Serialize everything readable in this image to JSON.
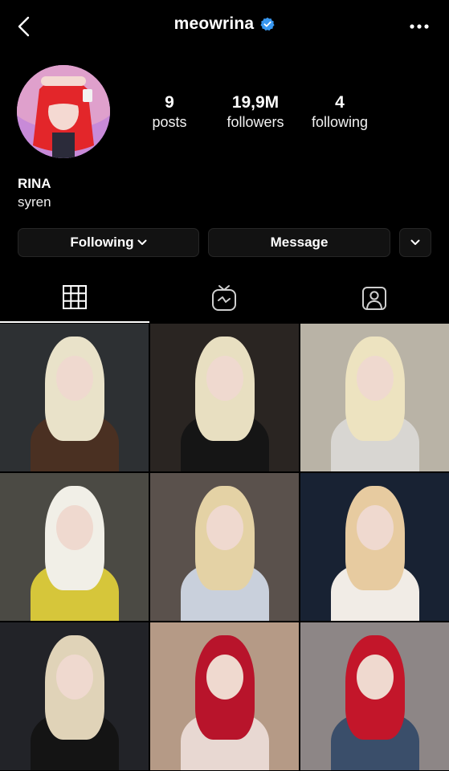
{
  "header": {
    "username": "meowrina",
    "back_icon": "chevron-left-icon",
    "verified_icon": "verified-badge-icon",
    "verified_color": "#3897f0",
    "more_icon": "more-horizontal-icon"
  },
  "profile": {
    "stats": {
      "posts_count": "9",
      "posts_label": "posts",
      "followers_count": "19,9M",
      "followers_label": "followers",
      "following_count": "4",
      "following_label": "following"
    },
    "display_name": "RINA",
    "bio": "syren"
  },
  "actions": {
    "following_label": "Following",
    "message_label": "Message"
  },
  "tabs": [
    {
      "icon": "grid-icon",
      "active": true
    },
    {
      "icon": "igtv-icon",
      "active": false
    },
    {
      "icon": "tagged-icon",
      "active": false
    }
  ],
  "grid": {
    "posts": [
      {
        "bg": "#2d3033",
        "hair": "#e9e2c9",
        "body": "#4a3022"
      },
      {
        "bg": "#2a2522",
        "hair": "#e8dfc1",
        "body": "#151515"
      },
      {
        "bg": "#b9b3a6",
        "hair": "#ede3c0",
        "body": "#d8d6d2"
      },
      {
        "bg": "#4b4a44",
        "hair": "#f1efe7",
        "body": "#d6c63a"
      },
      {
        "bg": "#5a514c",
        "hair": "#e4d2a5",
        "body": "#c9d0dc"
      },
      {
        "bg": "#182233",
        "hair": "#e7cba0",
        "body": "#f1ece6"
      },
      {
        "bg": "#222328",
        "hair": "#e0d3b8",
        "body": "#141414"
      },
      {
        "bg": "#b59a86",
        "hair": "#b8142b",
        "body": "#e8d8d2"
      },
      {
        "bg": "#8d8686",
        "hair": "#c3162a",
        "body": "#3a4e6a"
      }
    ]
  }
}
